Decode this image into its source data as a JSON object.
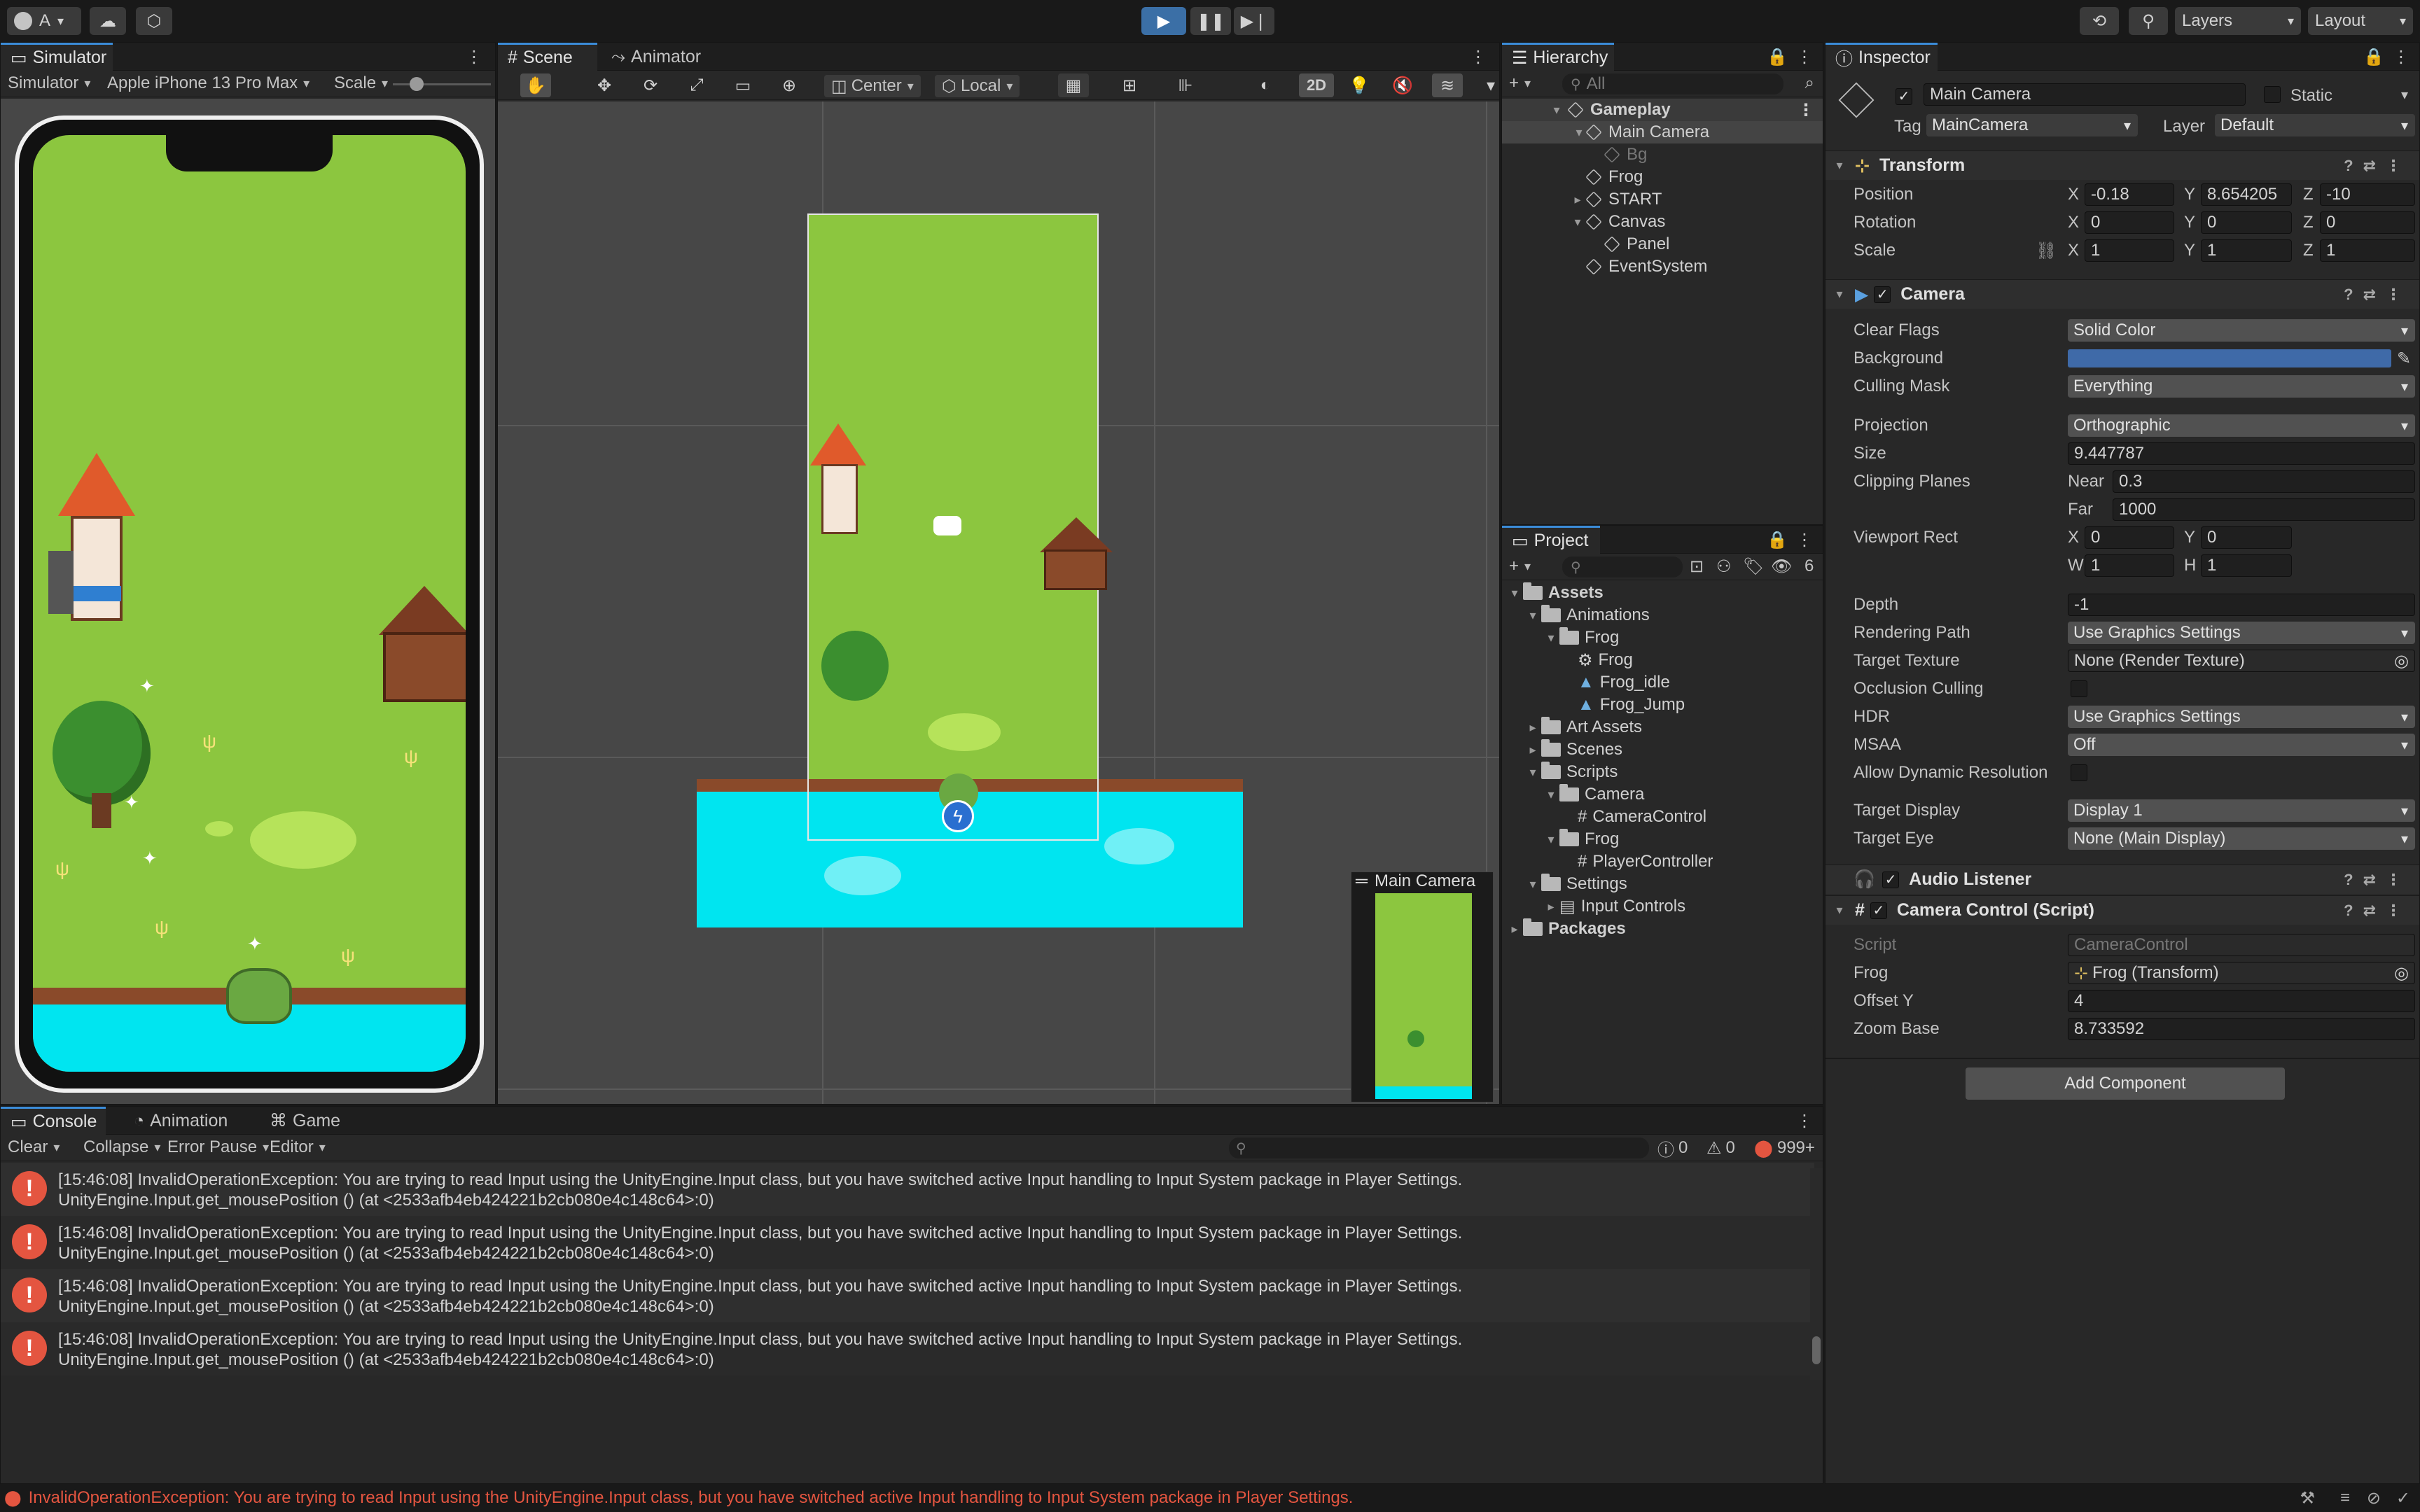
{
  "toolbar": {
    "account_label": "A",
    "layers_label": "Layers",
    "layout_label": "Layout"
  },
  "colors": {
    "accent": "#3b8cd9",
    "grass": "#8cc63f",
    "water": "#00e5f0",
    "camera_bg": "#3f6aa8",
    "error": "#e45540"
  },
  "simulator": {
    "tab": "Simulator",
    "mode": "Simulator",
    "device": "Apple iPhone 13 Pro Max",
    "scale_label": "Scale"
  },
  "scene": {
    "tabs": [
      "Scene",
      "Animator"
    ],
    "pivot": "Center",
    "space": "Local",
    "mode_2d": "2D",
    "preview_title": "Main Camera"
  },
  "hierarchy": {
    "tab": "Hierarchy",
    "search_placeholder": "All",
    "items": [
      {
        "label": "Gameplay"
      },
      {
        "label": "Main Camera"
      },
      {
        "label": "Bg"
      },
      {
        "label": "Frog"
      },
      {
        "label": "START"
      },
      {
        "label": "Canvas"
      },
      {
        "label": "Panel"
      },
      {
        "label": "EventSystem"
      }
    ]
  },
  "project": {
    "tab": "Project",
    "count": "6",
    "items": [
      {
        "label": "Assets"
      },
      {
        "label": "Animations"
      },
      {
        "label": "Frog"
      },
      {
        "label": "Frog"
      },
      {
        "label": "Frog_idle"
      },
      {
        "label": "Frog_Jump"
      },
      {
        "label": "Art Assets"
      },
      {
        "label": "Scenes"
      },
      {
        "label": "Scripts"
      },
      {
        "label": "Camera"
      },
      {
        "label": "CameraControl"
      },
      {
        "label": "Frog"
      },
      {
        "label": "PlayerController"
      },
      {
        "label": "Settings"
      },
      {
        "label": "Input Controls"
      },
      {
        "label": "Packages"
      }
    ]
  },
  "inspector": {
    "tab": "Inspector",
    "object_name": "Main Camera",
    "static_label": "Static",
    "tag_label": "Tag",
    "tag_value": "MainCamera",
    "layer_label": "Layer",
    "layer_value": "Default",
    "transform": {
      "title": "Transform",
      "position_label": "Position",
      "rotation_label": "Rotation",
      "scale_label": "Scale",
      "position": {
        "x": "-0.18",
        "y": "8.654205",
        "z": "-10"
      },
      "rotation": {
        "x": "0",
        "y": "0",
        "z": "0"
      },
      "scale": {
        "x": "1",
        "y": "1",
        "z": "1"
      }
    },
    "camera": {
      "title": "Camera",
      "clear_flags_label": "Clear Flags",
      "clear_flags": "Solid Color",
      "background_label": "Background",
      "culling_mask_label": "Culling Mask",
      "culling_mask": "Everything",
      "projection_label": "Projection",
      "projection": "Orthographic",
      "size_label": "Size",
      "size": "9.447787",
      "clipping_label": "Clipping Planes",
      "near_label": "Near",
      "near": "0.3",
      "far_label": "Far",
      "far": "1000",
      "viewport_label": "Viewport Rect",
      "vp_x": "0",
      "vp_y": "0",
      "vp_w": "1",
      "vp_h": "1",
      "depth_label": "Depth",
      "depth": "-1",
      "rendering_path_label": "Rendering Path",
      "rendering_path": "Use Graphics Settings",
      "target_texture_label": "Target Texture",
      "target_texture": "None (Render Texture)",
      "occlusion_label": "Occlusion Culling",
      "hdr_label": "HDR",
      "hdr": "Use Graphics Settings",
      "msaa_label": "MSAA",
      "msaa": "Off",
      "dynamic_res_label": "Allow Dynamic Resolution",
      "target_display_label": "Target Display",
      "target_display": "Display 1",
      "target_eye_label": "Target Eye",
      "target_eye": "None (Main Display)"
    },
    "audio_listener": {
      "title": "Audio Listener"
    },
    "camera_control": {
      "title": "Camera Control (Script)",
      "script_label": "Script",
      "script": "CameraControl",
      "frog_label": "Frog",
      "frog": "Frog (Transform)",
      "offset_y_label": "Offset Y",
      "offset_y": "4",
      "zoom_base_label": "Zoom Base",
      "zoom_base": "8.733592"
    },
    "add_component": "Add Component"
  },
  "console": {
    "tabs": [
      "Console",
      "Animation",
      "Game"
    ],
    "clear": "Clear",
    "collapse": "Collapse",
    "error_pause": "Error Pause",
    "editor": "Editor",
    "counts": {
      "logs": "0",
      "warnings": "0",
      "errors": "999+"
    },
    "entries": [
      {
        "line1": "[15:46:08] InvalidOperationException: You are trying to read Input using the UnityEngine.Input class, but you have switched active Input handling to Input System package in Player Settings.",
        "line2": "UnityEngine.Input.get_mousePosition () (at <2533afb4eb424221b2cb080e4c148c64>:0)"
      },
      {
        "line1": "[15:46:08] InvalidOperationException: You are trying to read Input using the UnityEngine.Input class, but you have switched active Input handling to Input System package in Player Settings.",
        "line2": "UnityEngine.Input.get_mousePosition () (at <2533afb4eb424221b2cb080e4c148c64>:0)"
      },
      {
        "line1": "[15:46:08] InvalidOperationException: You are trying to read Input using the UnityEngine.Input class, but you have switched active Input handling to Input System package in Player Settings.",
        "line2": "UnityEngine.Input.get_mousePosition () (at <2533afb4eb424221b2cb080e4c148c64>:0)"
      },
      {
        "line1": "[15:46:08] InvalidOperationException: You are trying to read Input using the UnityEngine.Input class, but you have switched active Input handling to Input System package in Player Settings.",
        "line2": "UnityEngine.Input.get_mousePosition () (at <2533afb4eb424221b2cb080e4c148c64>:0)"
      }
    ]
  },
  "status_bar": {
    "message": "InvalidOperationException: You are trying to read Input using the UnityEngine.Input class, but you have switched active Input handling to Input System package in Player Settings."
  }
}
